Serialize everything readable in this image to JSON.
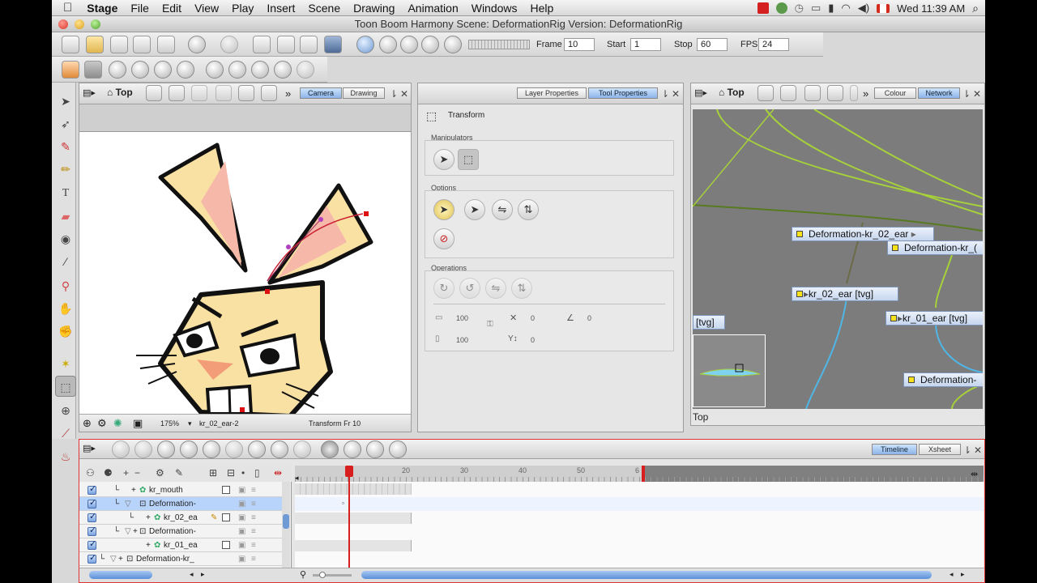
{
  "menubar": {
    "apple": "",
    "app": "Stage",
    "items": [
      "File",
      "Edit",
      "View",
      "Play",
      "Insert",
      "Scene",
      "Drawing",
      "Animation",
      "Windows",
      "Help"
    ],
    "clock": "Wed 11:39 AM"
  },
  "window": {
    "title": "Toon Boom Harmony Scene: DeformationRig Version: DeformationRig"
  },
  "playback": {
    "frame_label": "Frame",
    "frame": "10",
    "start_label": "Start",
    "start": "1",
    "stop_label": "Stop",
    "stop": "60",
    "fps_label": "FPS",
    "fps": "24"
  },
  "camera_view": {
    "home_label": "Top",
    "tabs": [
      "Camera",
      "Drawing"
    ],
    "active_tab": "Camera",
    "zoom": "175%",
    "drawing_name": "kr_02_ear-2",
    "status": "Transform Fr 10"
  },
  "tool_properties": {
    "tabs": [
      "Layer Properties",
      "Tool Properties"
    ],
    "active_tab": "Tool Properties",
    "tool_name": "Transform",
    "manipulators_label": "Manipulators",
    "options_label": "Options",
    "operations_label": "Operations",
    "fields": {
      "width": "100",
      "height": "100",
      "x": "0",
      "y": "0",
      "angle": "0",
      "skew": "0"
    }
  },
  "network_view": {
    "home_label": "Top",
    "tabs": [
      "Colour",
      "Network"
    ],
    "active_tab": "Network",
    "nodes": [
      "Deformation-kr_02_ear",
      "Deformation-kr_(",
      "kr_02_ear [tvg]",
      "kr_01_ear [tvg]",
      "[tvg]",
      "Deformation-"
    ],
    "status": "Top"
  },
  "timeline": {
    "tabs": [
      "Timeline",
      "Xsheet"
    ],
    "active_tab": "Timeline",
    "ruler": [
      "20",
      "30",
      "40",
      "50",
      "6"
    ],
    "layers": [
      {
        "name": "kr_mouth",
        "indent": 1
      },
      {
        "name": "Deformation-",
        "indent": 1
      },
      {
        "name": "kr_02_ea",
        "indent": 2
      },
      {
        "name": "Deformation-",
        "indent": 1
      },
      {
        "name": "kr_01_ea",
        "indent": 2
      },
      {
        "name": "Deformation-kr_",
        "indent": 0
      }
    ]
  },
  "colors": {
    "selection": "#b9d4fb",
    "playhead": "#d81f1f",
    "network_bg": "#7c7c7c",
    "wire_green": "#a6d13a",
    "wire_blue": "#4fb6e6"
  }
}
